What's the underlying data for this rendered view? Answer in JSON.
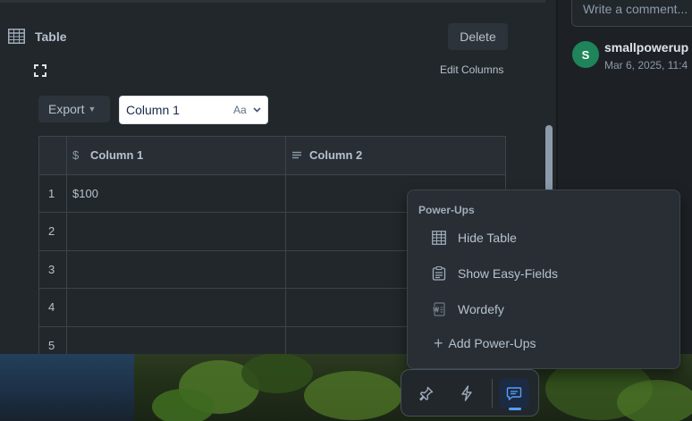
{
  "activity": {
    "comment_placeholder": "Write a comment...",
    "avatar_initial": "S",
    "user": "smallpowerup",
    "timestamp": "Mar 6, 2025, 11:4"
  },
  "table_section": {
    "title": "Table",
    "delete_label": "Delete",
    "edit_columns_label": "Edit Columns",
    "export_label": "Export",
    "column_select_value": "Column 1",
    "column_select_format": "Aa"
  },
  "table": {
    "headers": [
      {
        "label": "Column 1",
        "icon": "dollar-icon"
      },
      {
        "label": "Column 2",
        "icon": "text-lines-icon"
      }
    ],
    "rows": [
      {
        "num": "1",
        "c1": "$100",
        "c2": ""
      },
      {
        "num": "2",
        "c1": "",
        "c2": ""
      },
      {
        "num": "3",
        "c1": "",
        "c2": ""
      },
      {
        "num": "4",
        "c1": "",
        "c2": ""
      },
      {
        "num": "5",
        "c1": "",
        "c2": ""
      }
    ]
  },
  "powerups_menu": {
    "title": "Power-Ups",
    "items": [
      {
        "label": "Hide Table",
        "icon": "table-icon"
      },
      {
        "label": "Show Easy-Fields",
        "icon": "form-icon"
      },
      {
        "label": "Wordefy",
        "icon": "word-doc-icon"
      }
    ],
    "add_label": "Add Power-Ups"
  },
  "toolbar": {
    "buttons": [
      "pin-icon",
      "lightning-icon",
      "comment-icon"
    ],
    "active": "comment-icon"
  },
  "colors": {
    "accent": "#579dff",
    "avatar_green": "#1f845a"
  }
}
